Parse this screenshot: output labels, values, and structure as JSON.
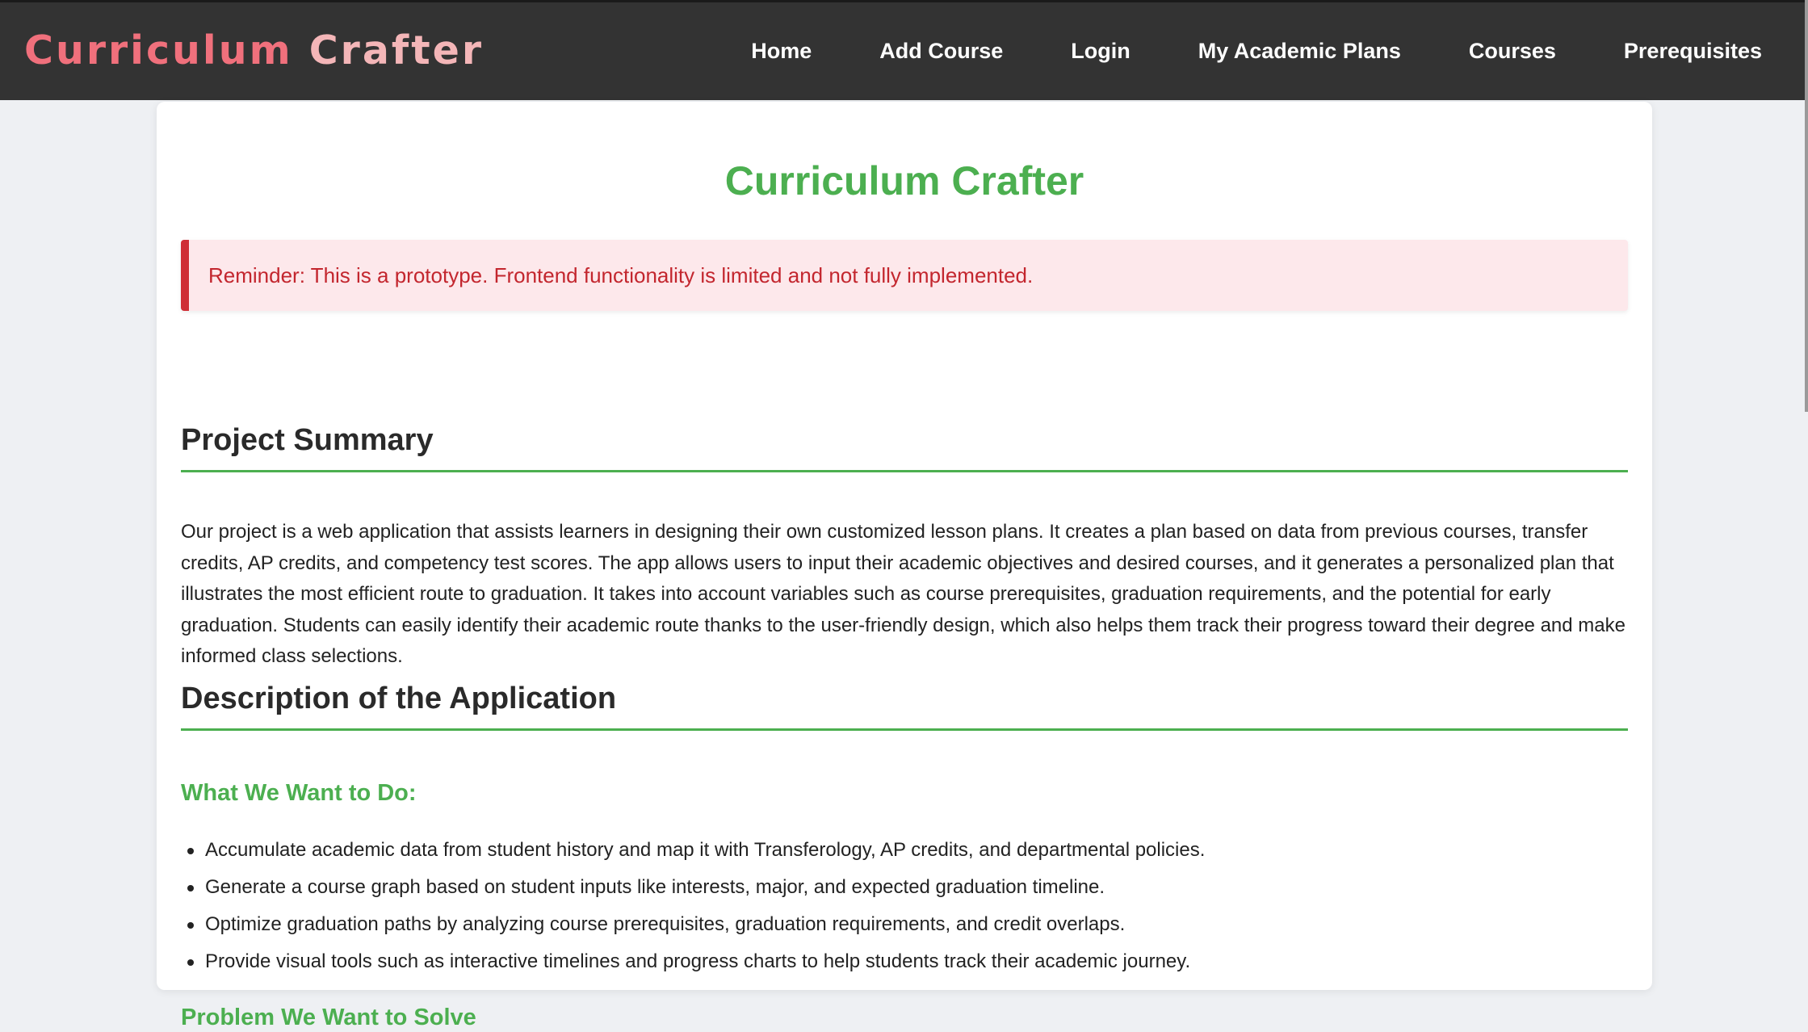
{
  "nav": {
    "brand_part1": "Curriculum",
    "brand_part2": "Crafter",
    "links": [
      {
        "label": "Home"
      },
      {
        "label": "Add Course"
      },
      {
        "label": "Login"
      },
      {
        "label": "My Academic Plans"
      },
      {
        "label": "Courses"
      },
      {
        "label": "Prerequisites"
      }
    ]
  },
  "main": {
    "title": "Curriculum Crafter",
    "alert": "Reminder: This is a prototype. Frontend functionality is limited and not fully implemented.",
    "summary": {
      "heading": "Project Summary",
      "text": "Our project is a web application that assists learners in designing their own customized lesson plans. It creates a plan based on data from previous courses, transfer credits, AP credits, and competency test scores. The app allows users to input their academic objectives and desired courses, and it generates a personalized plan that illustrates the most efficient route to graduation. It takes into account variables such as course prerequisites, graduation requirements, and the potential for early graduation. Students can easily identify their academic route thanks to the user-friendly design, which also helps them track their progress toward their degree and make informed class selections."
    },
    "description": {
      "heading": "Description of the Application",
      "goals_heading": "What We Want to Do:",
      "goals": [
        "Accumulate academic data from student history and map it with Transferology, AP credits, and departmental policies.",
        "Generate a course graph based on student inputs like interests, major, and expected graduation timeline.",
        "Optimize graduation paths by analyzing course prerequisites, graduation requirements, and credit overlaps.",
        "Provide visual tools such as interactive timelines and progress charts to help students track their academic journey."
      ],
      "problem_heading": "Problem We Want to Solve"
    }
  },
  "colors": {
    "navbar_bg": "#333333",
    "brand": "#f0707c",
    "accent_green": "#4caf50",
    "alert_bg": "#fde8eb",
    "alert_text": "#c3262e"
  }
}
